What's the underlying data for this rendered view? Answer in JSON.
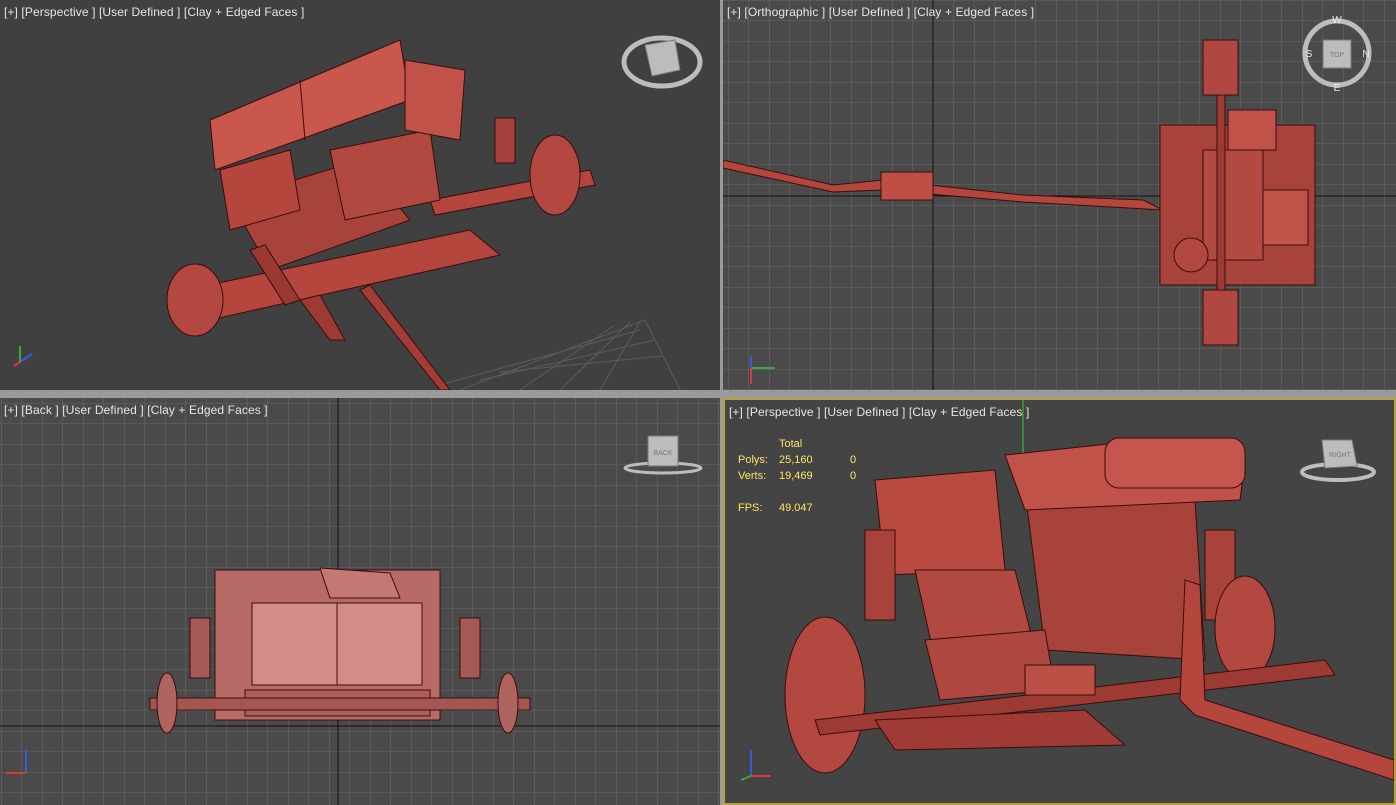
{
  "viewports": {
    "top_left": {
      "label": "[+] [Perspective ] [User Defined ] [Clay + Edged Faces ]",
      "viewcube": "orbit-viewcube-icon"
    },
    "top_right": {
      "label": "[+] [Orthographic ] [User Defined ] [Clay + Edged Faces ]",
      "viewcube_face": "TOP",
      "compass": [
        "W",
        "S",
        "N",
        "E"
      ]
    },
    "bottom_left": {
      "label": "[+] [Back ] [User Defined ] [Clay + Edged Faces ]",
      "viewcube_face": "BACK"
    },
    "bottom_right": {
      "label": "[+] [Perspective ] [User Defined ] [Clay + Edged Faces ]",
      "viewcube_face": "RIGHT",
      "stats": {
        "header": "Total",
        "polys_label": "Polys:",
        "polys_value": "25,160",
        "polys_sel": "0",
        "verts_label": "Verts:",
        "verts_value": "19,469",
        "verts_sel": "0",
        "fps_label": "FPS:",
        "fps_value": "49.047"
      }
    }
  },
  "axes": {
    "x": "x",
    "y": "y",
    "z": "z"
  },
  "colors": {
    "active_border": "#b8a23a",
    "stats_text": "#ffe46a",
    "model": "#b5463e",
    "grid": "#6a6a6a"
  }
}
